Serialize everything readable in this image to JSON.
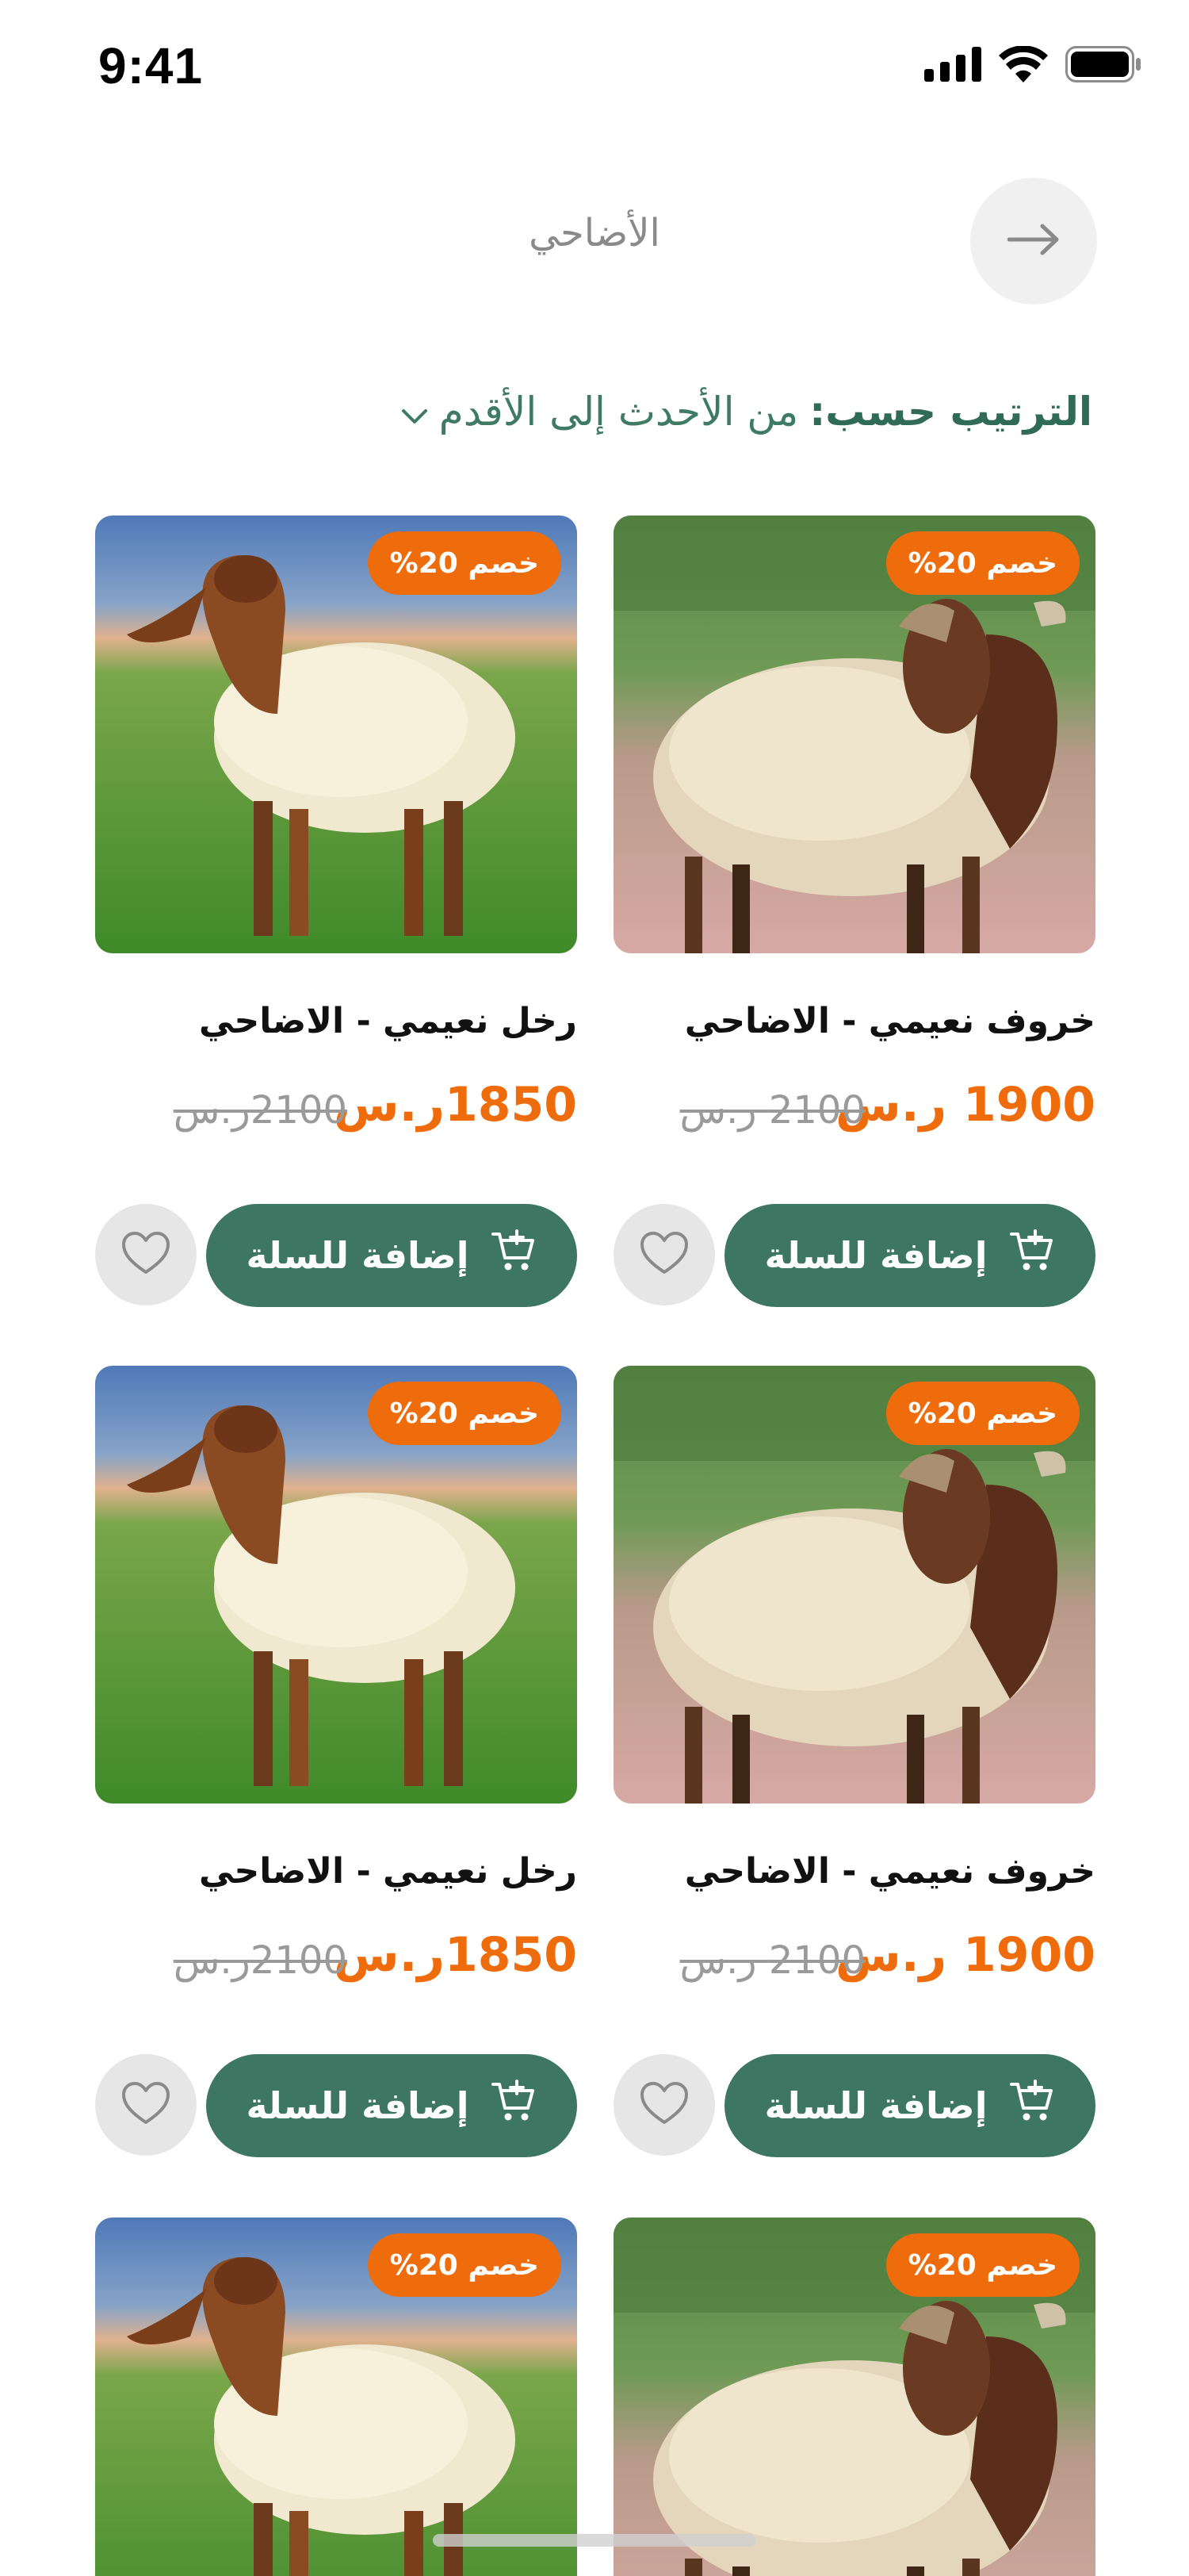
{
  "status_bar": {
    "time": "9:41",
    "icons": [
      "signal-icon",
      "wifi-icon",
      "battery-icon"
    ]
  },
  "header": {
    "title": "الأضاحي",
    "back_icon": "arrow-right-icon"
  },
  "sort": {
    "label": "الترتيب حسب:",
    "value": "من الأحدث إلى الأقدم",
    "icon": "chevron-down-icon"
  },
  "colors": {
    "accent_green": "#3d7663",
    "accent_orange": "#ef6c0c",
    "muted": "#9a9a9a"
  },
  "products": [
    {
      "name": "خروف نعيمي - الاضاحي",
      "price": "1900 ر.س",
      "old_price": "2100 ر.س",
      "badge": "خصم 20%",
      "cart_label": "إضافة للسلة",
      "image": "sheep-brown-head"
    },
    {
      "name": "رخل نعيمي - الاضاحي",
      "price": "1850ر.س",
      "old_price": "2100ر.س",
      "badge": "خصم 20%",
      "cart_label": "إضافة للسلة",
      "image": "sheep-white-field"
    },
    {
      "name": "خروف نعيمي - الاضاحي",
      "price": "1900 ر.س",
      "old_price": "2100 ر.س",
      "badge": "خصم 20%",
      "cart_label": "إضافة للسلة",
      "image": "sheep-brown-head"
    },
    {
      "name": "رخل نعيمي - الاضاحي",
      "price": "1850ر.س",
      "old_price": "2100ر.س",
      "badge": "خصم 20%",
      "cart_label": "إضافة للسلة",
      "image": "sheep-white-field"
    },
    {
      "name": "",
      "price": "",
      "old_price": "",
      "badge": "خصم 20%",
      "cart_label": "",
      "image": "sheep-brown-head"
    },
    {
      "name": "",
      "price": "",
      "old_price": "",
      "badge": "خصم 20%",
      "cart_label": "",
      "image": "sheep-white-field"
    }
  ]
}
